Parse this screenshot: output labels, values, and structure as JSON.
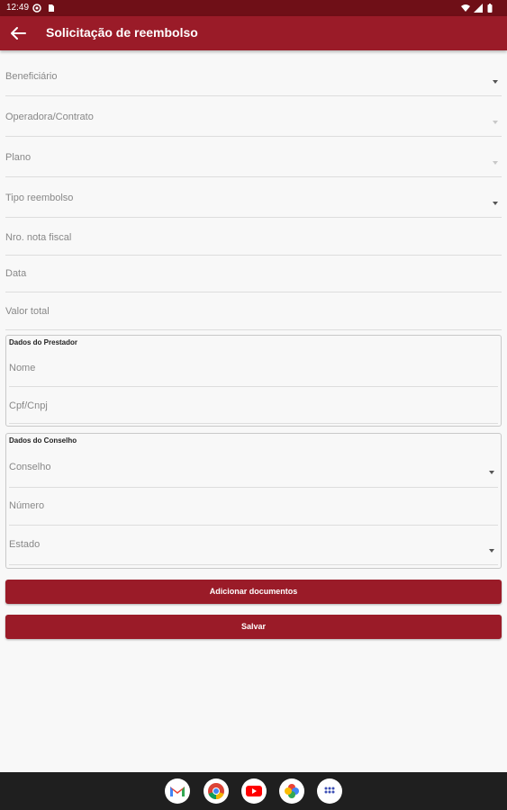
{
  "status_bar": {
    "time": "12:49"
  },
  "app_bar": {
    "title": "Solicitação de reembolso"
  },
  "form": {
    "beneficiario": "Beneficiário",
    "operadora": "Operadora/Contrato",
    "plano": "Plano",
    "tipo_reembolso": "Tipo reembolso",
    "nota_fiscal": "Nro. nota fiscal",
    "data": "Data",
    "valor_total": "Valor total"
  },
  "prestador": {
    "title": "Dados do Prestador",
    "nome": "Nome",
    "cpf_cnpj": "Cpf/Cnpj"
  },
  "conselho": {
    "title": "Dados do Conselho",
    "conselho": "Conselho",
    "numero": "Número",
    "estado": "Estado"
  },
  "buttons": {
    "add_documents": "Adicionar documentos",
    "save": "Salvar"
  },
  "dock": {
    "apps": [
      "gmail-icon",
      "chrome-icon",
      "youtube-icon",
      "photos-icon",
      "app-drawer-icon"
    ]
  },
  "colors": {
    "primary": "#9a1b28",
    "status_bar": "#6f0f17",
    "background": "#f8f8f8"
  }
}
